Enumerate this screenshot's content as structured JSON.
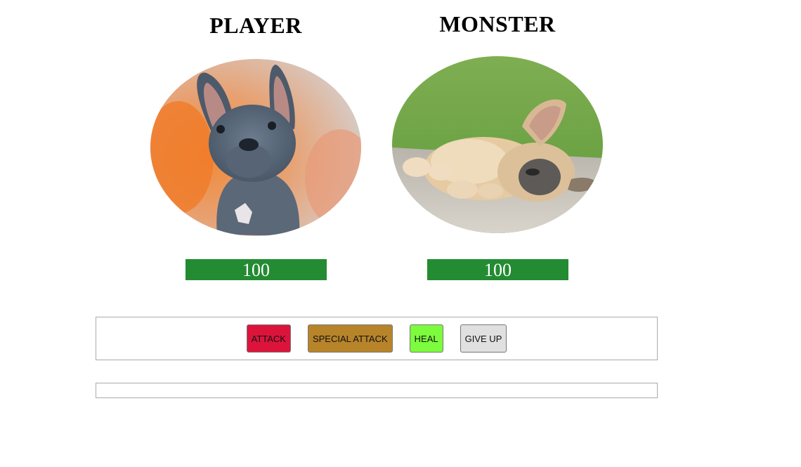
{
  "player": {
    "title": "PLAYER",
    "portrait_icon": "dog-photo-icon",
    "health": 100,
    "health_fraction": 1.0,
    "health_color": "#238b32"
  },
  "monster": {
    "title": "MONSTER",
    "portrait_icon": "dog-photo-icon",
    "health": 100,
    "health_fraction": 1.0,
    "health_color": "#238b32"
  },
  "controls": {
    "attack_label": "ATTACK",
    "special_attack_label": "SPECIAL ATTACK",
    "heal_label": "HEAL",
    "give_up_label": "GIVE UP",
    "attack_color": "#dc143c",
    "special_attack_color": "#b8842a",
    "heal_color": "#7cfc3c",
    "give_up_color": "#e0e0e0"
  },
  "log": {
    "entries": []
  }
}
